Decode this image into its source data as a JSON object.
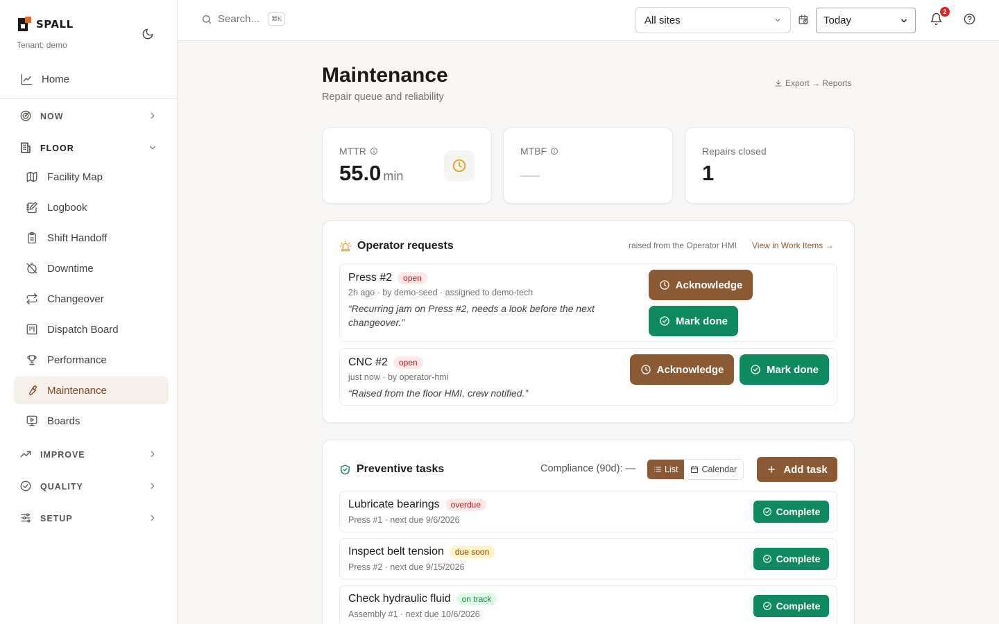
{
  "brand": {
    "name": "SPALL",
    "tenant": "Tenant: demo"
  },
  "nav": {
    "home": "Home",
    "now": "NOW",
    "floor": "FLOOR",
    "floor_items": [
      "Facility Map",
      "Logbook",
      "Shift Handoff",
      "Downtime",
      "Changeover",
      "Dispatch Board",
      "Performance",
      "Maintenance",
      "Boards"
    ],
    "improve": "IMPROVE",
    "quality": "QUALITY",
    "setup": "SETUP"
  },
  "topbar": {
    "search_placeholder": "Search...",
    "search_shortcut": "⌘K",
    "sites_value": "All sites",
    "date_value": "Today",
    "notification_count": "2"
  },
  "page": {
    "title": "Maintenance",
    "subtitle": "Repair queue and reliability",
    "export_label": "Export → Reports"
  },
  "kpis": {
    "mttr": {
      "label": "MTTR",
      "value": "55.0",
      "unit": "min"
    },
    "mtbf": {
      "label": "MTBF",
      "value": "—"
    },
    "repairs": {
      "label": "Repairs closed",
      "value": "1"
    }
  },
  "operator_requests": {
    "title": "Operator requests",
    "meta": "raised from the Operator HMI",
    "link": "View in Work Items →",
    "acknowledge_label": "Acknowledge",
    "done_label": "Mark done",
    "items": [
      {
        "machine": "Press #2",
        "status": "open",
        "meta": "2h ago · by demo-seed · assigned to demo-tech",
        "quote": "“Recurring jam on Press #2, needs a look before the next changeover.”"
      },
      {
        "machine": "CNC #2",
        "status": "open",
        "meta": "just now · by operator-hmi",
        "quote": "“Raised from the floor HMI, crew notified.”"
      }
    ]
  },
  "preventive": {
    "title": "Preventive tasks",
    "compliance": "Compliance (90d): —",
    "view_list": "List",
    "view_calendar": "Calendar",
    "add_label": "Add task",
    "complete_label": "Complete",
    "tasks": [
      {
        "name": "Lubricate bearings",
        "status": "overdue",
        "meta": "Press #1 · next due 9/6/2026"
      },
      {
        "name": "Inspect belt tension",
        "status": "due soon",
        "meta": "Press #2 · next due 9/15/2026"
      },
      {
        "name": "Check hydraulic fluid",
        "status": "on track",
        "meta": "Assembly #1 · next due 10/6/2026"
      }
    ]
  },
  "colors": {
    "accent": "#8a5a34",
    "success": "#0f8a5f",
    "danger": "#dc2626"
  }
}
